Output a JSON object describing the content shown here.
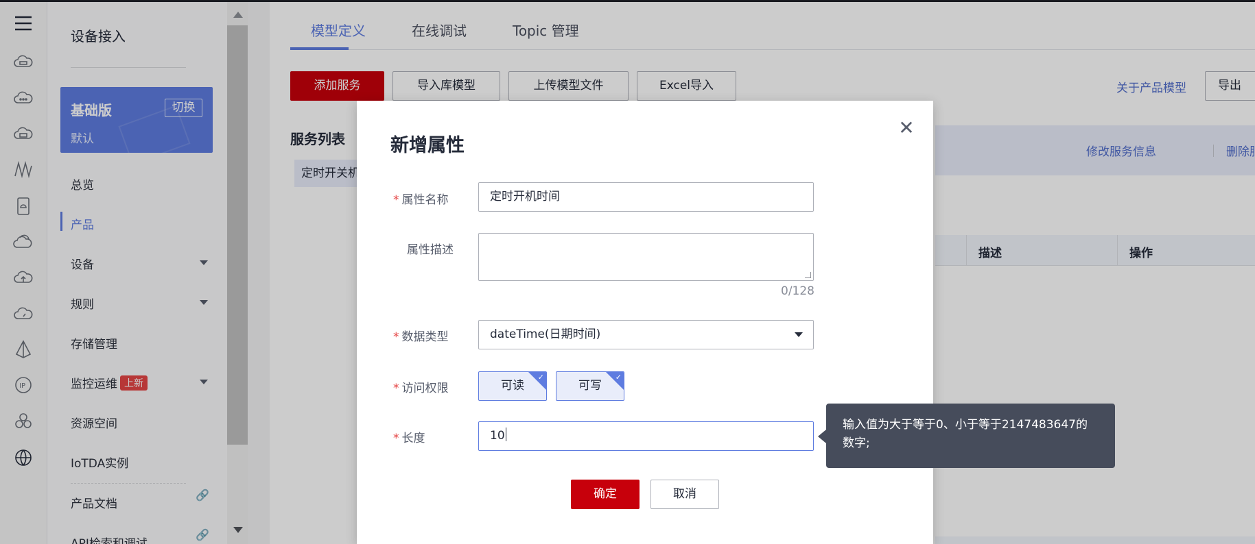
{
  "colors": {
    "brand_red": "#c7000b",
    "accent_blue": "#5e7ce0",
    "link_blue": "#526ecc",
    "required_red": "#e54545",
    "tooltip_bg": "#464c5b"
  },
  "rail": {
    "icons": [
      "menu-icon",
      "cloud-server-icon",
      "cloud-dots-icon",
      "cloud-device-icon",
      "signal-icon",
      "sim-card-icon",
      "cloud-stack-icon",
      "cloud-upload-icon",
      "cloud-gauge-icon",
      "pyramid-icon",
      "ip-icon",
      "cluster-icon",
      "globe-icon"
    ]
  },
  "sidebar": {
    "title": "设备接入",
    "plan": {
      "name": "基础版",
      "switch_label": "切换",
      "subtitle": "默认"
    },
    "items": [
      {
        "label": "总览"
      },
      {
        "label": "产品",
        "active": true
      },
      {
        "label": "设备",
        "expandable": true
      },
      {
        "label": "规则",
        "expandable": true
      },
      {
        "label": "存储管理"
      },
      {
        "label": "监控运维",
        "badge": "上新",
        "expandable": true
      },
      {
        "label": "资源空间"
      },
      {
        "label": "IoTDA实例"
      },
      {
        "label": "产品文档",
        "external": true
      },
      {
        "label": "API检索和调试",
        "external": true
      }
    ]
  },
  "main": {
    "tabs": [
      {
        "label": "模型定义",
        "active": true
      },
      {
        "label": "在线调试"
      },
      {
        "label": "Topic 管理"
      }
    ],
    "toolbar": {
      "add_service": "添加服务",
      "import_library_model": "导入库模型",
      "upload_model_file": "上传模型文件",
      "excel_import": "Excel导入",
      "about_model": "关于产品模型",
      "export": "导出"
    },
    "service_list_title": "服务列表",
    "service_item": "定时开关机",
    "service_actions": {
      "edit": "修改服务信息",
      "delete": "删除服务"
    },
    "table_headers": {
      "description": "描述",
      "operation": "操作"
    }
  },
  "dialog": {
    "title": "新增属性",
    "fields": {
      "name": {
        "label": "属性名称",
        "value": "定时开机时间",
        "required": true
      },
      "description": {
        "label": "属性描述",
        "value": "",
        "counter": "0/128",
        "required": false
      },
      "data_type": {
        "label": "数据类型",
        "value": "dateTime(日期时间)",
        "required": true
      },
      "access": {
        "label": "访问权限",
        "options": [
          "可读",
          "可写"
        ],
        "selected": [
          "可读",
          "可写"
        ],
        "required": true
      },
      "length": {
        "label": "长度",
        "value": "10",
        "required": true
      }
    },
    "confirm_label": "确定",
    "cancel_label": "取消"
  },
  "tooltip": {
    "text": "输入值为大于等于0、小于等于2147483647的数字;"
  }
}
